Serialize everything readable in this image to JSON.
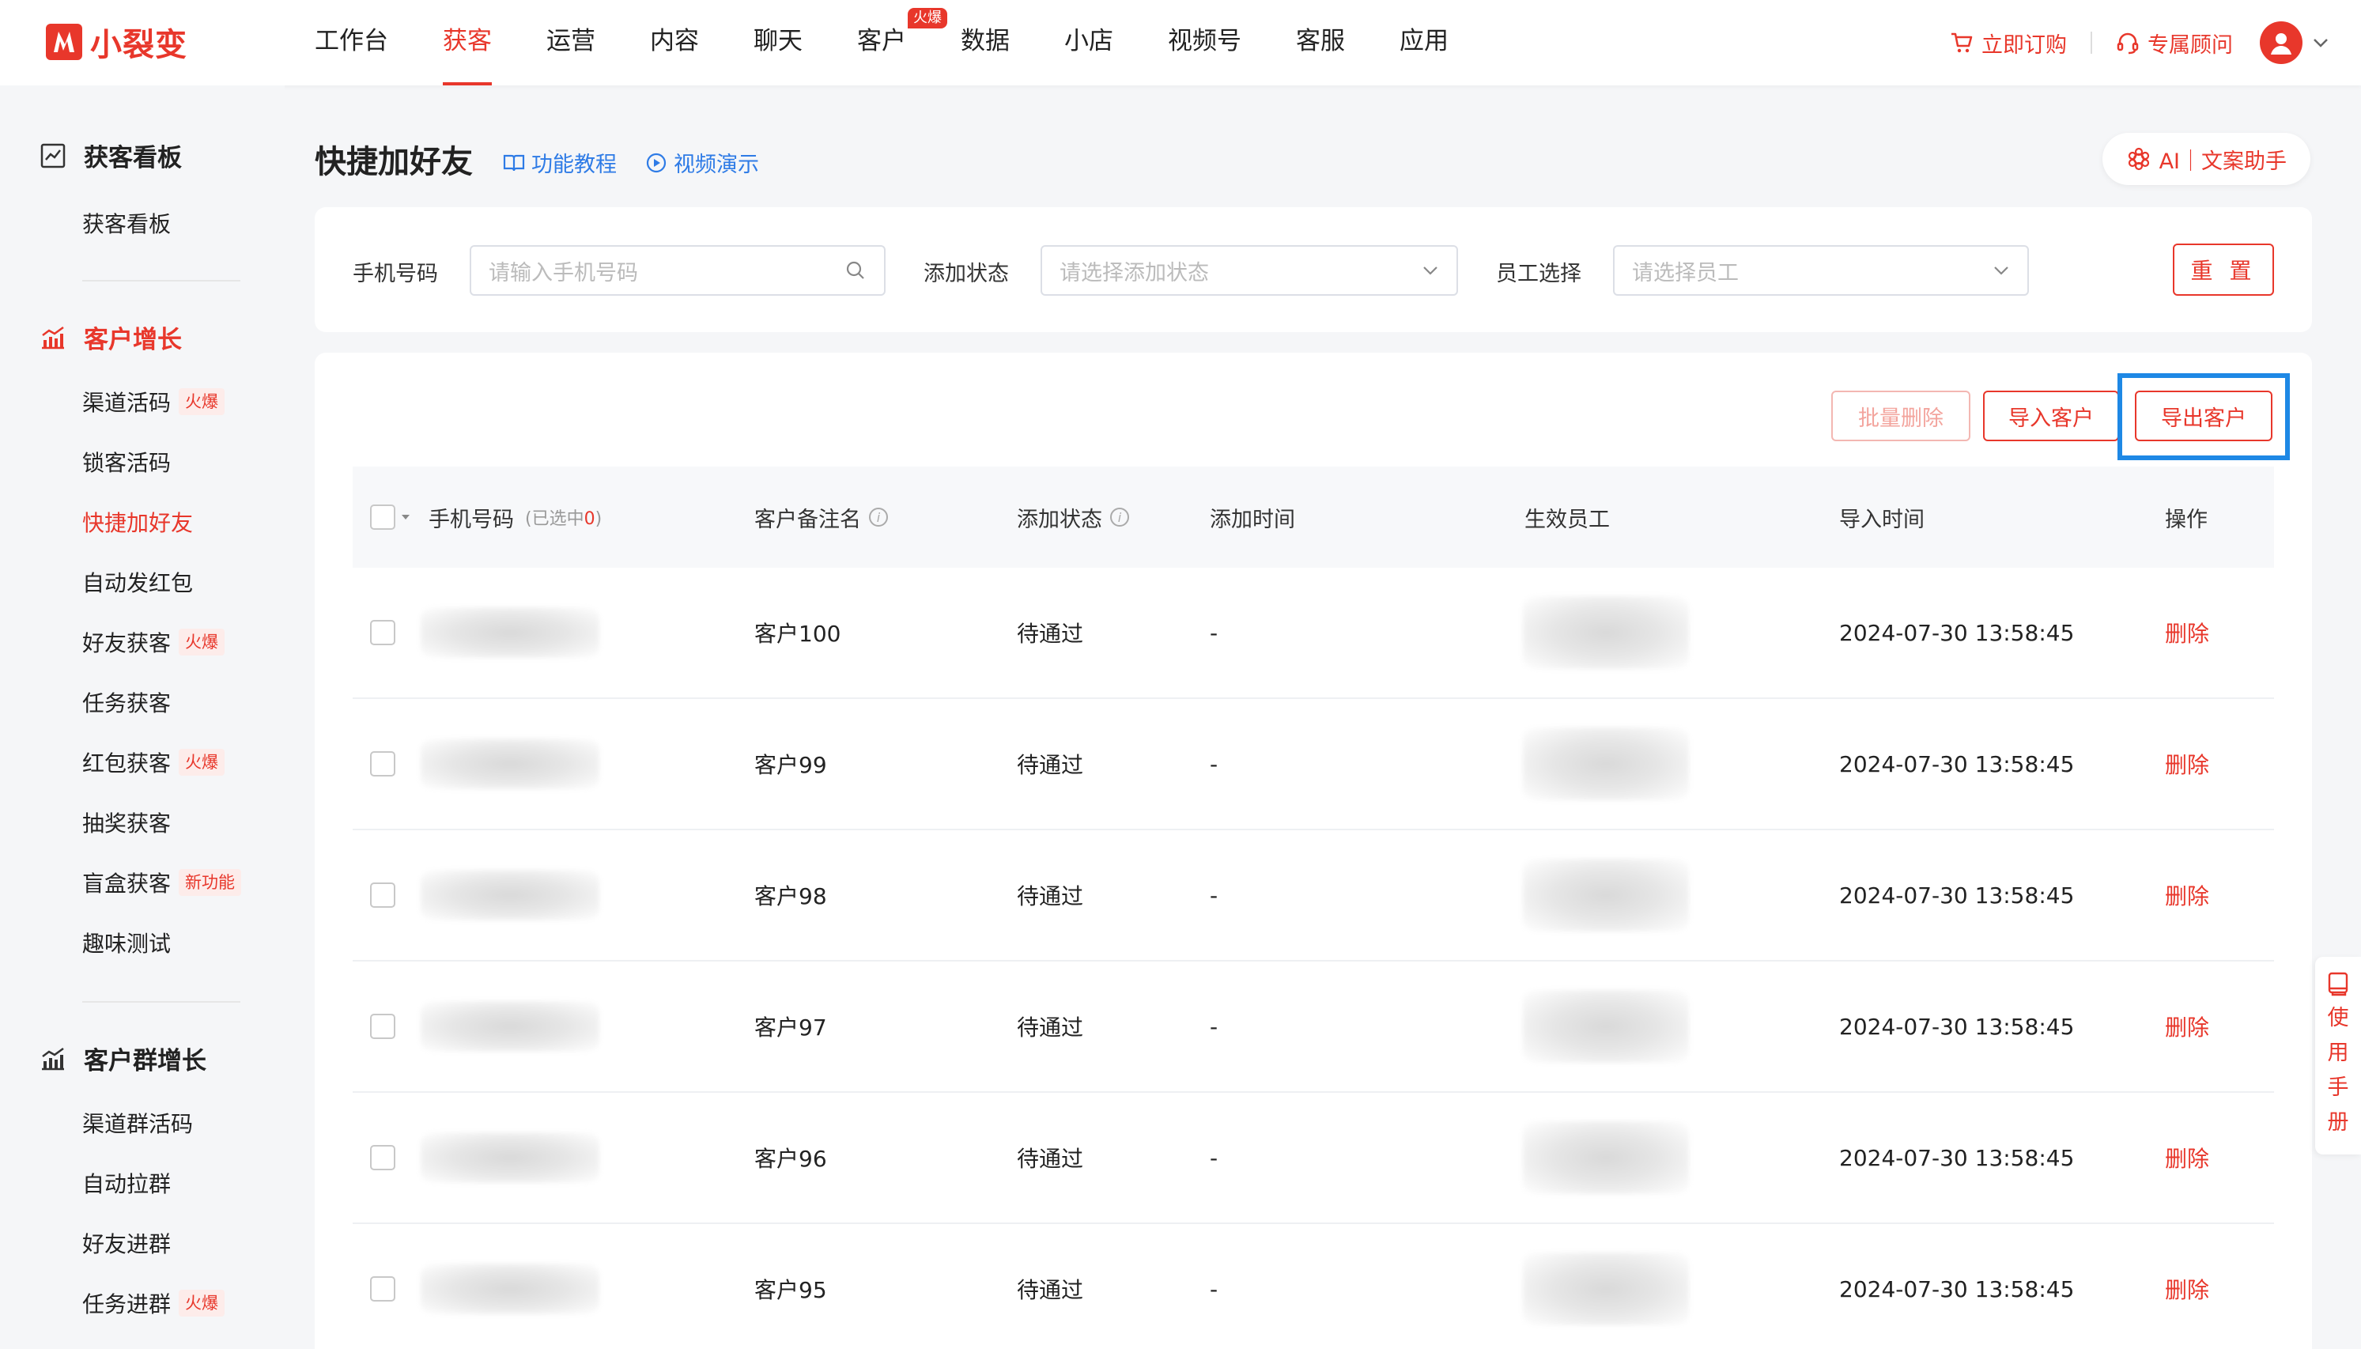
{
  "brand": {
    "name": "小裂变",
    "color": "#e8372b"
  },
  "nav": {
    "items": [
      {
        "label": "工作台"
      },
      {
        "label": "获客",
        "active": true
      },
      {
        "label": "运营"
      },
      {
        "label": "内容"
      },
      {
        "label": "聊天"
      },
      {
        "label": "客户",
        "badge": "火爆"
      },
      {
        "label": "数据"
      },
      {
        "label": "小店"
      },
      {
        "label": "视频号"
      },
      {
        "label": "客服"
      },
      {
        "label": "应用"
      }
    ],
    "order_label": "立即订购",
    "advisor_label": "专属顾问"
  },
  "sidebar": {
    "groups": [
      {
        "title": "获客看板",
        "icon": "chart-board-icon",
        "items": [
          {
            "label": "获客看板"
          }
        ]
      },
      {
        "title": "客户增长",
        "icon": "growth-icon",
        "active": true,
        "items": [
          {
            "label": "渠道活码",
            "tag": "火爆"
          },
          {
            "label": "锁客活码"
          },
          {
            "label": "快捷加好友",
            "active": true
          },
          {
            "label": "自动发红包"
          },
          {
            "label": "好友获客",
            "tag": "火爆"
          },
          {
            "label": "任务获客"
          },
          {
            "label": "红包获客",
            "tag": "火爆"
          },
          {
            "label": "抽奖获客"
          },
          {
            "label": "盲盒获客",
            "tag": "新功能"
          },
          {
            "label": "趣味测试"
          }
        ]
      },
      {
        "title": "客户群增长",
        "icon": "growth-icon",
        "items": [
          {
            "label": "渠道群活码"
          },
          {
            "label": "自动拉群"
          },
          {
            "label": "好友进群"
          },
          {
            "label": "任务进群",
            "tag": "火爆"
          }
        ]
      }
    ]
  },
  "page": {
    "title": "快捷加好友",
    "tutorial_label": "功能教程",
    "video_label": "视频演示",
    "ai_label": "AI｜文案助手"
  },
  "filters": {
    "phone_label": "手机号码",
    "phone_placeholder": "请输入手机号码",
    "status_label": "添加状态",
    "status_placeholder": "请选择添加状态",
    "staff_label": "员工选择",
    "staff_placeholder": "请选择员工",
    "reset_label": "重 置"
  },
  "actions": {
    "batch_delete": "批量删除",
    "import": "导入客户",
    "export": "导出客户"
  },
  "table": {
    "columns": {
      "phone": "手机号码",
      "selected_prefix": "(已选中",
      "selected_count": "0",
      "selected_suffix": ")",
      "remark": "客户备注名",
      "status": "添加状态",
      "add_time": "添加时间",
      "staff": "生效员工",
      "import_time": "导入时间",
      "ops": "操作"
    },
    "rows": [
      {
        "remark": "客户100",
        "status": "待通过",
        "add_time": "-",
        "import_time": "2024-07-30 13:58:45",
        "op": "删除"
      },
      {
        "remark": "客户99",
        "status": "待通过",
        "add_time": "-",
        "import_time": "2024-07-30 13:58:45",
        "op": "删除"
      },
      {
        "remark": "客户98",
        "status": "待通过",
        "add_time": "-",
        "import_time": "2024-07-30 13:58:45",
        "op": "删除"
      },
      {
        "remark": "客户97",
        "status": "待通过",
        "add_time": "-",
        "import_time": "2024-07-30 13:58:45",
        "op": "删除"
      },
      {
        "remark": "客户96",
        "status": "待通过",
        "add_time": "-",
        "import_time": "2024-07-30 13:58:45",
        "op": "删除"
      },
      {
        "remark": "客户95",
        "status": "待通过",
        "add_time": "-",
        "import_time": "2024-07-30 13:58:45",
        "op": "删除"
      }
    ]
  },
  "float": {
    "manual_label": "使用手册"
  }
}
